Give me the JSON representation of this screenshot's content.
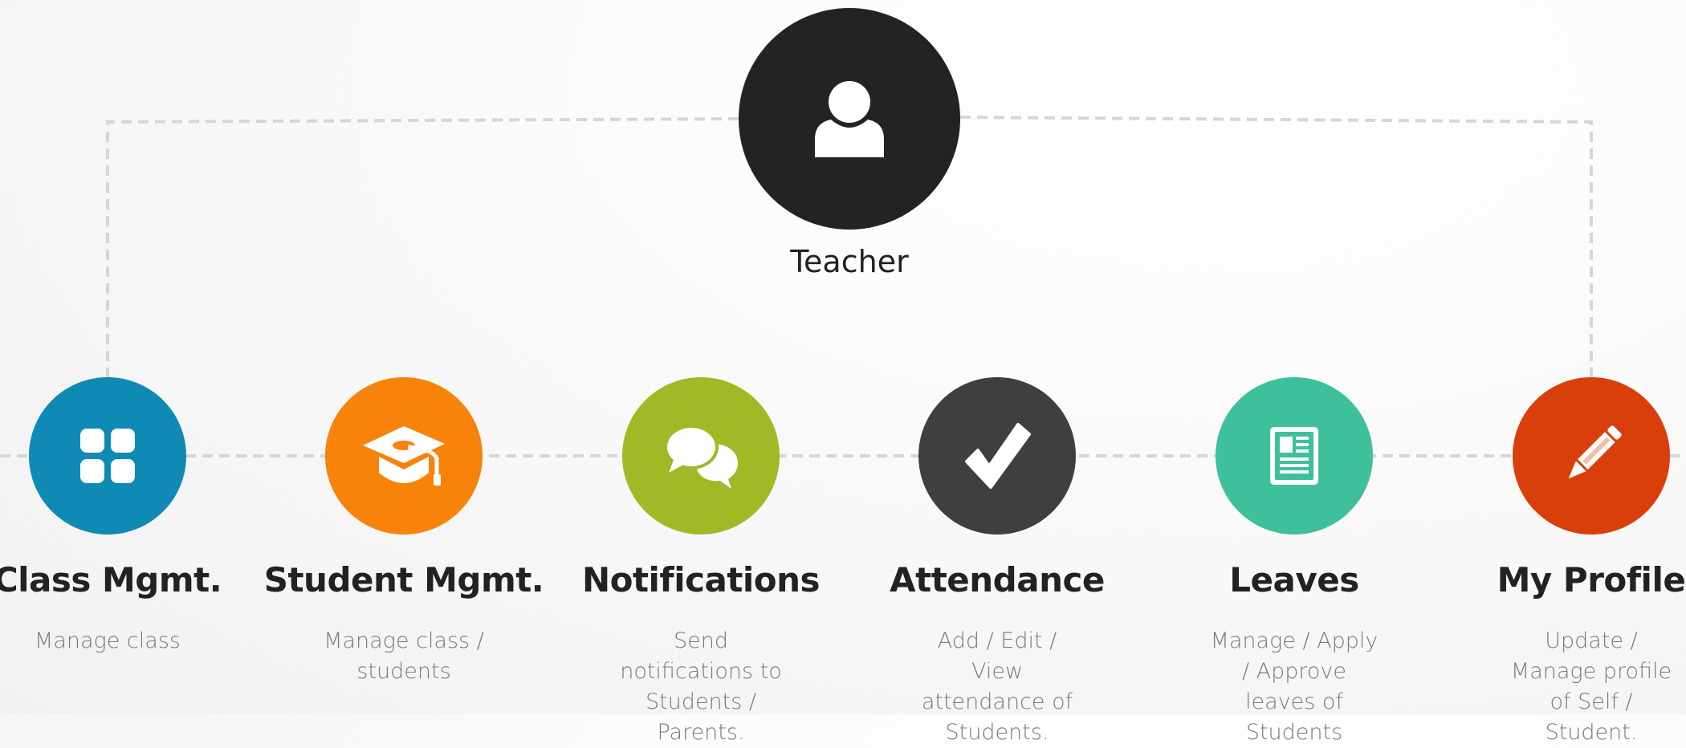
{
  "root": {
    "label": "Teacher",
    "icon": "user-icon",
    "color": "#232323"
  },
  "features": [
    {
      "title": "Class Mgmt.",
      "description": "Manage class",
      "color": "#0f8ab5",
      "icon": "grid-icon"
    },
    {
      "title": "Student Mgmt.",
      "description": "Manage class / students",
      "color": "#f8830a",
      "icon": "graduation-cap-icon"
    },
    {
      "title": "Notifications",
      "description": "Send notifications to Students / Parents.",
      "color": "#9fba26",
      "icon": "chat-bubbles-icon"
    },
    {
      "title": "Attendance",
      "description": "Add / Edit / View attendance of Students.",
      "color": "#3f3f3f",
      "icon": "checkmark-icon"
    },
    {
      "title": "Leaves",
      "description": "Manage / Apply / Approve leaves of Students",
      "color": "#3fc09c",
      "icon": "document-icon"
    },
    {
      "title": "My Profile",
      "description": "Update / Manage profile of Self / Student.",
      "color": "#d83f0a",
      "icon": "pencil-icon"
    }
  ]
}
